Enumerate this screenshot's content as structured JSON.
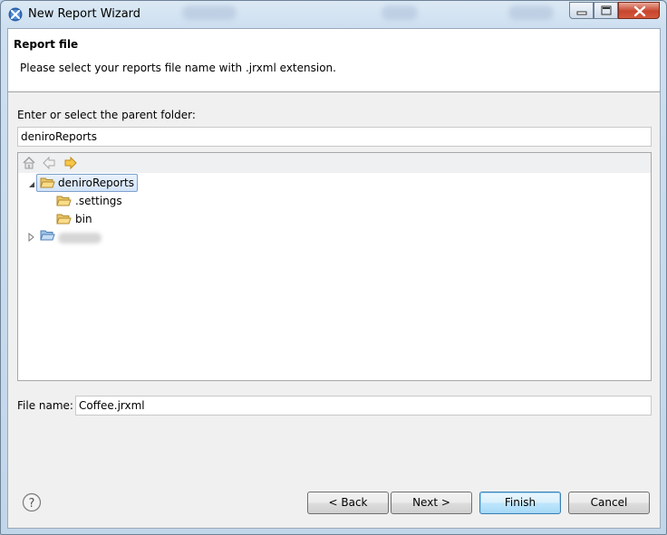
{
  "window": {
    "title": "New Report Wizard"
  },
  "header": {
    "title": "Report file",
    "description": "Please select your reports file name with .jrxml extension."
  },
  "folder_section": {
    "label": "Enter or select the parent folder:",
    "value": "deniroReports"
  },
  "tree": {
    "toolbar_icons": [
      "home-icon",
      "back-arrow-icon",
      "forward-arrow-icon"
    ],
    "items": [
      {
        "label": "deniroReports",
        "expanded": true,
        "selected": true,
        "level": 0
      },
      {
        "label": ".settings",
        "level": 1
      },
      {
        "label": "bin",
        "level": 1
      },
      {
        "label": "",
        "expanded": false,
        "level": 0,
        "obscured": true
      }
    ]
  },
  "file_section": {
    "label": "File name:",
    "value": "Coffee.jrxml"
  },
  "buttons": {
    "back": "< Back",
    "next": "Next >",
    "finish": "Finish",
    "cancel": "Cancel"
  },
  "colors": {
    "selection_border": "#7da2ce",
    "default_button_border": "#3c7fb1",
    "folder_icon": "#e8b64a"
  }
}
